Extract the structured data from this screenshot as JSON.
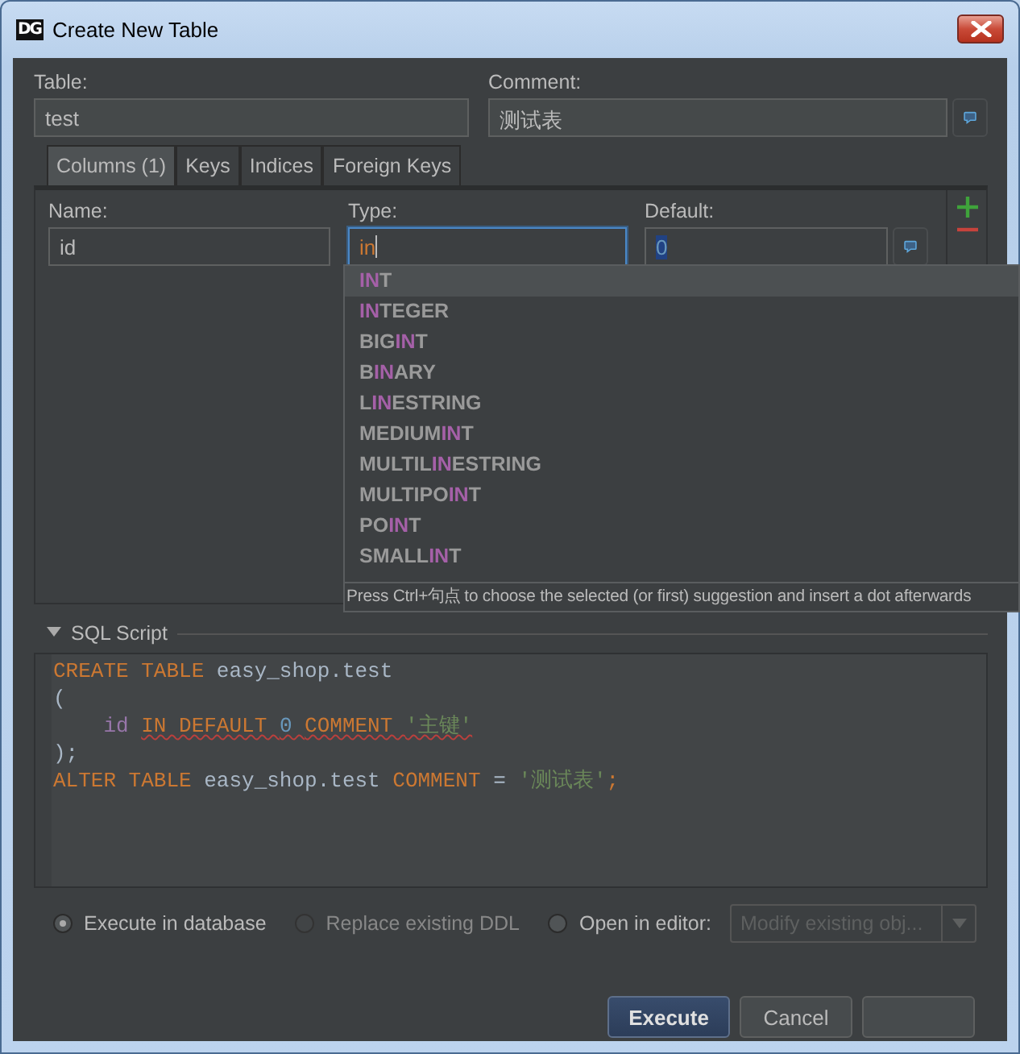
{
  "window": {
    "title": "Create New Table",
    "app_icon": "DG"
  },
  "table": {
    "label": "Table:",
    "value": "test"
  },
  "comment": {
    "label": "Comment:",
    "value": "测试表"
  },
  "tabs": [
    {
      "label": "Columns (1)",
      "selected": true
    },
    {
      "label": "Keys",
      "selected": false
    },
    {
      "label": "Indices",
      "selected": false
    },
    {
      "label": "Foreign Keys",
      "selected": false
    }
  ],
  "column": {
    "name_label": "Name:",
    "name": "id",
    "type_label": "Type:",
    "type": "in",
    "type_focused": true,
    "default_label": "Default:",
    "default": "0",
    "default_selected": true
  },
  "completion": {
    "items": [
      {
        "selected": true,
        "parts": [
          {
            "text": "IN",
            "match": true
          },
          {
            "text": "T",
            "match": false
          }
        ]
      },
      {
        "selected": false,
        "parts": [
          {
            "text": "IN",
            "match": true
          },
          {
            "text": "TEGER",
            "match": false
          }
        ]
      },
      {
        "selected": false,
        "parts": [
          {
            "text": "BIG",
            "match": false
          },
          {
            "text": "IN",
            "match": true
          },
          {
            "text": "T",
            "match": false
          }
        ]
      },
      {
        "selected": false,
        "parts": [
          {
            "text": "B",
            "match": false
          },
          {
            "text": "IN",
            "match": true
          },
          {
            "text": "ARY",
            "match": false
          }
        ]
      },
      {
        "selected": false,
        "parts": [
          {
            "text": "L",
            "match": false
          },
          {
            "text": "IN",
            "match": true
          },
          {
            "text": "ESTRING",
            "match": false
          }
        ]
      },
      {
        "selected": false,
        "parts": [
          {
            "text": "MEDIUM",
            "match": false
          },
          {
            "text": "IN",
            "match": true
          },
          {
            "text": "T",
            "match": false
          }
        ]
      },
      {
        "selected": false,
        "parts": [
          {
            "text": "MULTIL",
            "match": false
          },
          {
            "text": "IN",
            "match": true
          },
          {
            "text": "ESTRING",
            "match": false
          }
        ]
      },
      {
        "selected": false,
        "parts": [
          {
            "text": "MULTIPO",
            "match": false
          },
          {
            "text": "IN",
            "match": true
          },
          {
            "text": "T",
            "match": false
          }
        ]
      },
      {
        "selected": false,
        "parts": [
          {
            "text": "PO",
            "match": false
          },
          {
            "text": "IN",
            "match": true
          },
          {
            "text": "T",
            "match": false
          }
        ]
      },
      {
        "selected": false,
        "parts": [
          {
            "text": "SMALL",
            "match": false
          },
          {
            "text": "IN",
            "match": true
          },
          {
            "text": "T",
            "match": false
          }
        ]
      }
    ],
    "hint": "Press Ctrl+句点 to choose the selected (or first) suggestion and insert a dot afterwards"
  },
  "sql_script": {
    "title": "SQL Script",
    "expanded": true,
    "lines": [
      {
        "indent": false,
        "tokens": [
          {
            "kind": "keyword",
            "text": "CREATE TABLE "
          },
          {
            "kind": "plain",
            "text": "easy_shop.test"
          }
        ]
      },
      {
        "indent": false,
        "tokens": [
          {
            "kind": "plain",
            "text": "("
          }
        ]
      },
      {
        "indent": true,
        "tokens": [
          {
            "kind": "field",
            "text": "id "
          },
          {
            "kind": "keyword",
            "text": "IN DEFAULT ",
            "error": true
          },
          {
            "kind": "number",
            "text": "0 ",
            "error": true
          },
          {
            "kind": "keyword",
            "text": "COMMENT ",
            "error": true
          },
          {
            "kind": "string",
            "text": "'主键'",
            "error": true
          }
        ]
      },
      {
        "indent": false,
        "tokens": [
          {
            "kind": "plain",
            "text": ");"
          }
        ]
      },
      {
        "indent": false,
        "tokens": [
          {
            "kind": "keyword",
            "text": "ALTER TABLE "
          },
          {
            "kind": "plain",
            "text": "easy_shop.test "
          },
          {
            "kind": "keyword",
            "text": "COMMENT "
          },
          {
            "kind": "plain",
            "text": "= "
          },
          {
            "kind": "string",
            "text": "'测试表'"
          },
          {
            "kind": "keyword",
            "text": ";"
          }
        ]
      }
    ]
  },
  "options": [
    {
      "label": "Execute in database",
      "selected": true,
      "disabled": false
    },
    {
      "label": "Replace existing DDL",
      "selected": false,
      "disabled": true
    },
    {
      "label": "Open in editor:",
      "selected": false,
      "disabled": false
    }
  ],
  "editor_mode": {
    "value": "Modify existing obj...",
    "disabled": true
  },
  "buttons": [
    {
      "label": "Execute",
      "default": true
    },
    {
      "label": "Cancel",
      "default": false
    }
  ]
}
